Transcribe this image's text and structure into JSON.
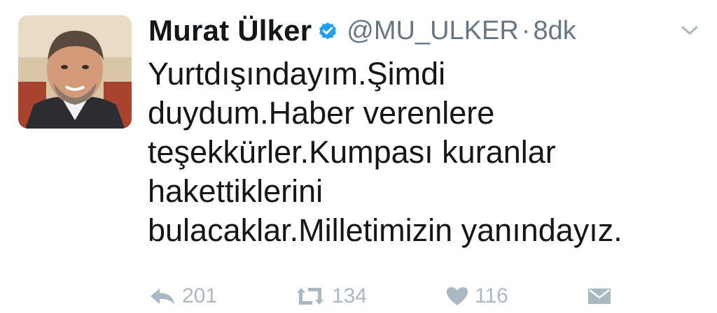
{
  "tweet": {
    "author_name": "Murat Ülker",
    "handle": "@MU_ULKER",
    "separator": "·",
    "timestamp": "8dk",
    "text_lines": [
      "Yurtdışındayım.Şimdi",
      "duydum.Haber verenlere",
      "teşekkürler.Kumpası kuranlar",
      "hakettiklerini",
      "bulacaklar.Milletimizin yanındayız."
    ]
  },
  "actions": {
    "reply_count": "201",
    "retweet_count": "134",
    "like_count": "116"
  },
  "icons": {
    "verified": "verified-badge-icon",
    "more": "chevron-down-icon",
    "reply": "reply-icon",
    "retweet": "retweet-icon",
    "like": "heart-icon",
    "dm": "envelope-icon"
  },
  "colors": {
    "text": "#14171a",
    "secondary": "#657786",
    "icon_gray": "#aab8c2",
    "verified_blue": "#1da1f2"
  }
}
